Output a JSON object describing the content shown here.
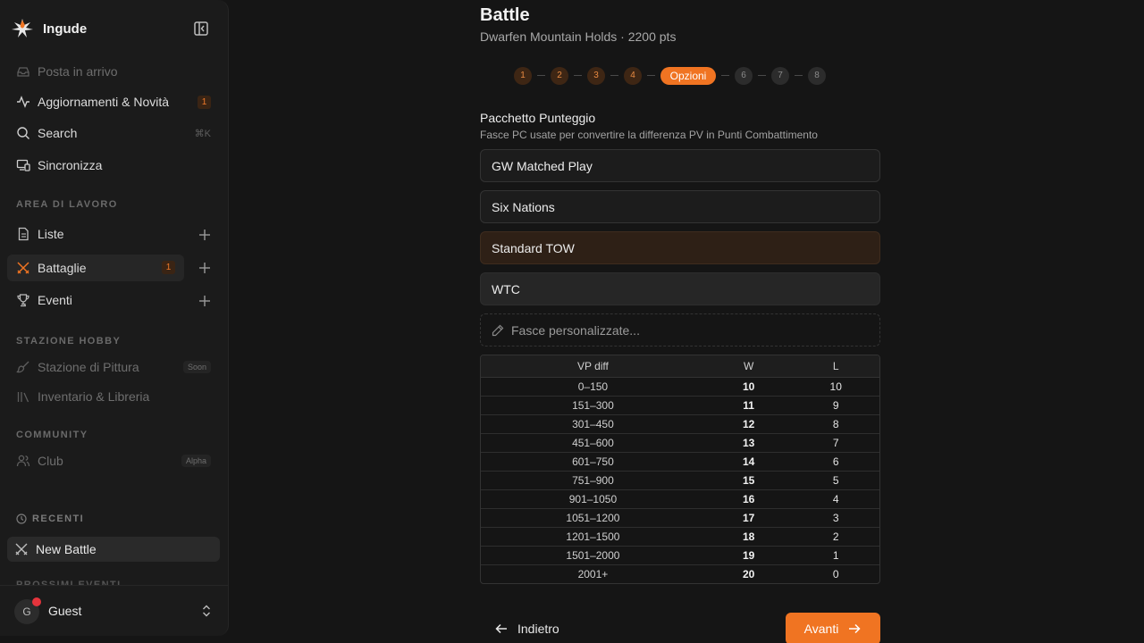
{
  "app": {
    "name": "Ingude"
  },
  "sidebar": {
    "inbox": "Posta in arrivo",
    "updates": {
      "label": "Aggiornamenti & Novità",
      "badge": "1"
    },
    "search": {
      "label": "Search",
      "shortcut": "⌘K"
    },
    "sync": "Sincronizza",
    "workspace_title": "AREA DI LAVORO",
    "lists": "Liste",
    "battles": {
      "label": "Battaglie",
      "badge": "1"
    },
    "events": "Eventi",
    "hobby_title": "STAZIONE HOBBY",
    "painting": {
      "label": "Stazione di Pittura",
      "pill": "Soon"
    },
    "inventory": "Inventario & Libreria",
    "community_title": "COMMUNITY",
    "club": {
      "label": "Club",
      "pill": "Alpha"
    },
    "recent_title": "RECENTI",
    "recent_item": "New Battle",
    "upcoming_title": "PROSSIMI EVENTI",
    "user": {
      "initial": "G",
      "name": "Guest"
    }
  },
  "main": {
    "title": "Battle",
    "subtitle": "Dwarfen Mountain Holds · 2200 pts",
    "steps": [
      "1",
      "2",
      "3",
      "4",
      "Opzioni",
      "6",
      "7",
      "8"
    ],
    "section_title": "Pacchetto Punteggio",
    "section_desc": "Fasce PC usate per convertire la differenza PV in Punti Combattimento",
    "options": [
      "GW Matched Play",
      "Six Nations",
      "Standard TOW",
      "WTC"
    ],
    "selected_option": "Standard TOW",
    "custom_option": "Fasce personalizzate...",
    "table": {
      "headers": [
        "VP diff",
        "W",
        "L"
      ],
      "rows": [
        [
          "0–150",
          "10",
          "10"
        ],
        [
          "151–300",
          "11",
          "9"
        ],
        [
          "301–450",
          "12",
          "8"
        ],
        [
          "451–600",
          "13",
          "7"
        ],
        [
          "601–750",
          "14",
          "6"
        ],
        [
          "751–900",
          "15",
          "5"
        ],
        [
          "901–1050",
          "16",
          "4"
        ],
        [
          "1051–1200",
          "17",
          "3"
        ],
        [
          "1201–1500",
          "18",
          "2"
        ],
        [
          "1501–2000",
          "19",
          "1"
        ],
        [
          "2001+",
          "20",
          "0"
        ]
      ]
    },
    "back_label": "Indietro",
    "next_label": "Avanti"
  },
  "colors": {
    "accent": "#f07422",
    "background": "#151515",
    "sidebar": "#1b1b1b"
  }
}
